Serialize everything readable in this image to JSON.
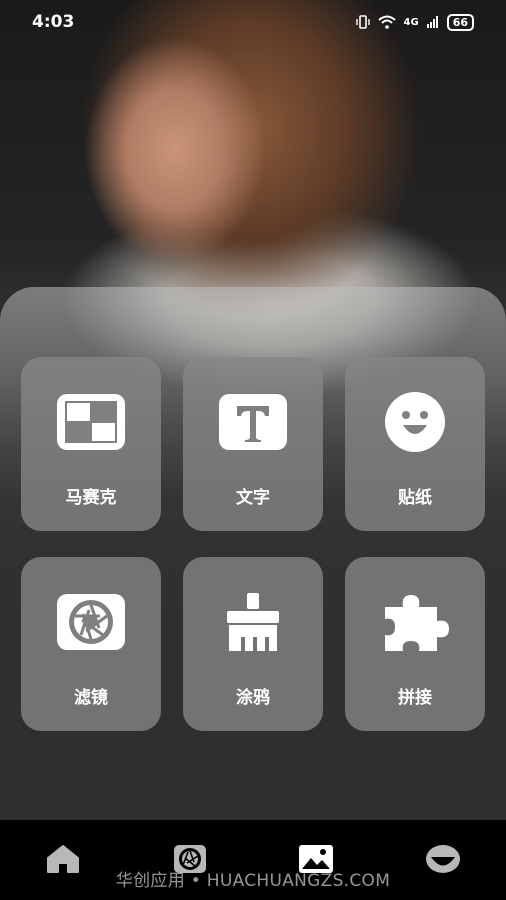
{
  "status_bar": {
    "time": "4:03",
    "network": "4G",
    "battery": "66"
  },
  "tools": [
    {
      "label": "马赛克",
      "icon": "mosaic-icon"
    },
    {
      "label": "文字",
      "icon": "text-icon"
    },
    {
      "label": "贴纸",
      "icon": "sticker-smiley-icon"
    },
    {
      "label": "滤镜",
      "icon": "filter-aperture-icon"
    },
    {
      "label": "涂鸦",
      "icon": "brush-icon"
    },
    {
      "label": "拼接",
      "icon": "puzzle-icon"
    }
  ],
  "bottom_nav": [
    {
      "icon": "home-icon"
    },
    {
      "icon": "aperture-icon"
    },
    {
      "icon": "image-icon",
      "active": true
    },
    {
      "icon": "face-icon"
    }
  ],
  "watermark": "华创应用 • HUACHUANGZS.COM",
  "colors": {
    "background": "#2f2f2f",
    "tile": "#878787",
    "nav_background": "#000000"
  }
}
